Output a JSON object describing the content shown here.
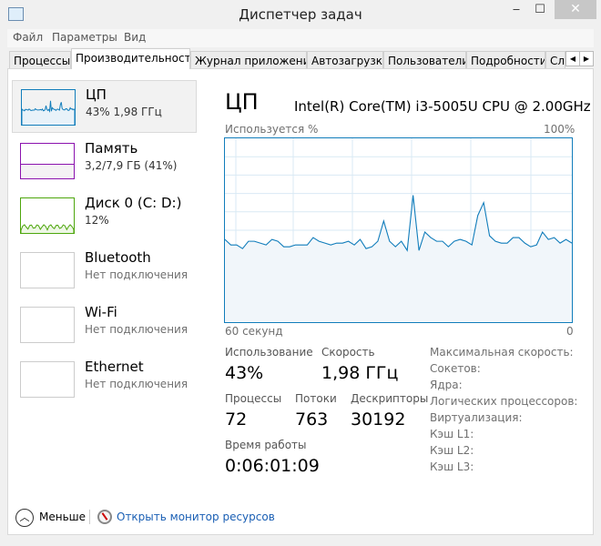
{
  "window": {
    "title": "Диспетчер задач",
    "minimize": "‒",
    "maximize": "☐",
    "close": "✕"
  },
  "menu": [
    "Файл",
    "Параметры",
    "Вид"
  ],
  "tabs": [
    "Процессы",
    "Производительность",
    "Журнал приложений",
    "Автозагрузка",
    "Пользователи",
    "Подробности",
    "Службы"
  ],
  "active_tab": "Производительность",
  "sidebar": [
    {
      "name": "ЦП",
      "sub": "43%  1,98 ГГц",
      "color": "#117dbb"
    },
    {
      "name": "Память",
      "sub": "3,2/7,9 ГБ (41%)",
      "color": "#8b12ae"
    },
    {
      "name": "Диск 0 (C: D:)",
      "sub": "12%",
      "color": "#4da60c"
    },
    {
      "name": "Bluetooth",
      "sub": "Нет подключения"
    },
    {
      "name": "Wi-Fi",
      "sub": "Нет подключения"
    },
    {
      "name": "Ethernet",
      "sub": "Нет подключения"
    }
  ],
  "main": {
    "title": "ЦП",
    "cpu_name": "Intel(R) Core(TM) i3-5005U CPU @ 2.00GHz",
    "stats": {
      "usage_label": "Использование",
      "usage": "43%",
      "speed_label": "Скорость",
      "speed": "1,98 ГГц",
      "proc_label": "Процессы",
      "proc": "72",
      "threads_label": "Потоки",
      "threads": "763",
      "handles_label": "Дескрипторы",
      "handles": "30192",
      "uptime_label": "Время работы",
      "uptime": "0:06:01:09"
    },
    "specs": [
      "Максимальная скорость:",
      "Сокетов:",
      "Ядра:",
      "Логических процессоров:",
      "Виртуализация:",
      "Кэш L1:",
      "Кэш L2:",
      "Кэш L3:"
    ]
  },
  "chart_data": {
    "type": "area",
    "ylabel": "Используется %",
    "ymax_label": "100%",
    "xleft_label": "60 секунд",
    "xright_label": "0",
    "ylim": [
      0,
      100
    ],
    "xlim": [
      60,
      0
    ],
    "grid": true,
    "color": "#117dbb",
    "values": [
      45,
      42,
      42,
      40,
      44,
      44,
      43,
      42,
      45,
      44,
      41,
      41,
      42,
      42,
      42,
      46,
      44,
      43,
      42,
      43,
      43,
      44,
      42,
      45,
      40,
      41,
      44,
      55,
      44,
      41,
      44,
      39,
      69,
      39,
      49,
      46,
      44,
      44,
      41,
      44,
      45,
      44,
      42,
      58,
      65,
      47,
      44,
      43,
      43,
      46,
      46,
      43,
      41,
      42,
      49,
      45,
      46,
      43,
      45,
      43
    ]
  },
  "memory_pct": 41,
  "footer": {
    "less": "Меньше",
    "monitor": "Открыть монитор ресурсов"
  }
}
